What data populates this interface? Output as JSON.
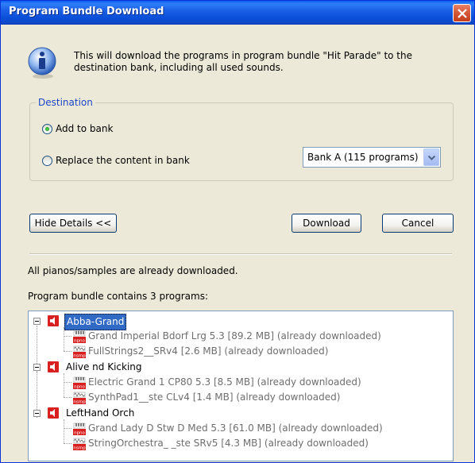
{
  "window": {
    "title": "Program Bundle Download"
  },
  "info": {
    "message": "This will download the programs in program bundle \"Hit Parade\" to the destination bank, including all used sounds."
  },
  "destination": {
    "legend": "Destination",
    "option_add": "Add to bank",
    "option_replace": "Replace the content in bank",
    "selected_option": "Add to bank",
    "bank_select_value": "Bank A (115 programs)"
  },
  "buttons": {
    "hide_details": "Hide Details <<",
    "download": "Download",
    "cancel": "Cancel"
  },
  "details": {
    "status": "All pianos/samples are already downloaded.",
    "summary": "Program bundle contains 3 programs:"
  },
  "tree": {
    "programs": [
      {
        "name": "Abba-Grand",
        "selected": true,
        "items": [
          {
            "type": "npno",
            "text": "Grand Imperial Bdorf Lrg 5.3 [89.2 MB] (already downloaded)"
          },
          {
            "type": "nsmp",
            "text": "FullStrings2__SRv4 [2.6 MB] (already downloaded)"
          }
        ]
      },
      {
        "name": "Alive nd Kicking",
        "selected": false,
        "items": [
          {
            "type": "npno",
            "text": "Electric Grand 1 CP80  5.3 [8.5 MB] (already downloaded)"
          },
          {
            "type": "nsmp",
            "text": "SynthPad1__ste CLv4 [1.4 MB] (already downloaded)"
          }
        ]
      },
      {
        "name": "LeftHand Orch",
        "selected": false,
        "items": [
          {
            "type": "npno",
            "text": "Grand Lady D   Stw D  Med 5.3 [61.0 MB] (already downloaded)"
          },
          {
            "type": "nsmp",
            "text": "StringOrchestra_ _ste SRv5 [4.3 MB] (already downloaded)"
          }
        ]
      }
    ]
  },
  "colors": {
    "titlebar": "#0a4fd8",
    "dialog_bg": "#ece9d8",
    "selection": "#316ac5",
    "group_legend": "#1b46c8",
    "speaker_icon": "#d82020"
  }
}
